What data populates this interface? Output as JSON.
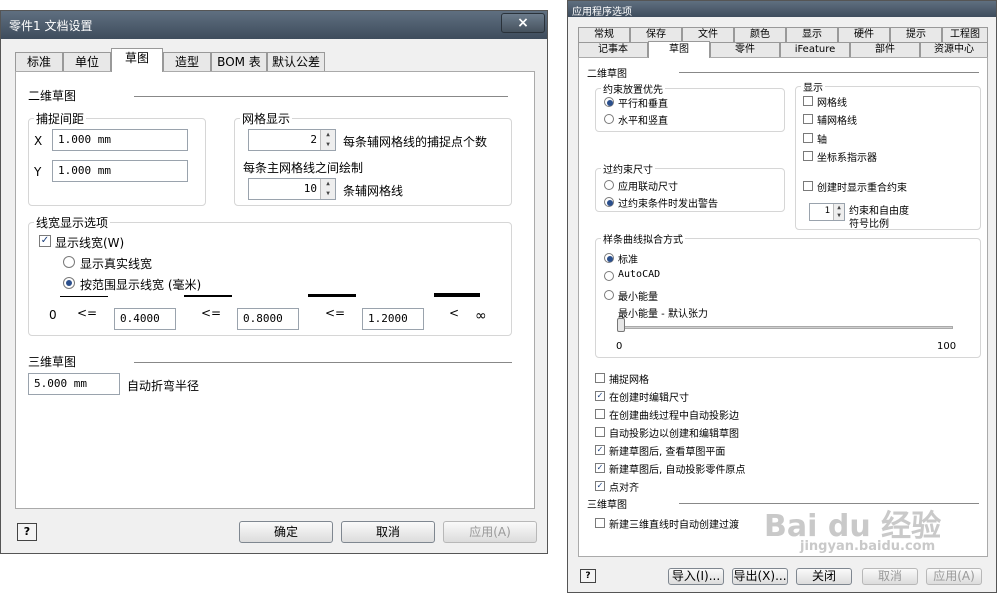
{
  "left": {
    "title": "零件1 文档设置",
    "close": "×",
    "tabs": [
      "标准",
      "单位",
      "草图",
      "造型",
      "BOM 表",
      "默认公差"
    ],
    "sketch2d_heading": "二维草图",
    "snap": {
      "label": "捕捉间距",
      "x_label": "X",
      "x_value": "1.000 mm",
      "y_label": "Y",
      "y_value": "1.000 mm"
    },
    "grid": {
      "label": "网格显示",
      "snap_per_minor": "2",
      "snap_per_minor_label": "每条辅网格线的捕捉点个数",
      "major_every_label": "每条主网格线之间绘制",
      "minor_per_major": "10",
      "minor_per_major_label": "条辅网格线"
    },
    "lineweight": {
      "label": "线宽显示选项",
      "display_label": "显示线宽(W)",
      "true_label": "显示真实线宽",
      "range_label": "按范围显示线宽 (毫米)",
      "zero": "0",
      "le": "<=",
      "lt": "<",
      "inf": "∞",
      "v1": "0.4000",
      "v2": "0.8000",
      "v3": "1.2000"
    },
    "sketch3d_heading": "三维草图",
    "bend_value": "5.000 mm",
    "bend_label": "自动折弯半径",
    "help": "?",
    "ok": "确定",
    "cancel": "取消",
    "apply": "应用(A)"
  },
  "right": {
    "title": "应用程序选项",
    "tabs_row1": [
      "常规",
      "保存",
      "文件",
      "颜色",
      "显示",
      "硬件",
      "提示",
      "工程图"
    ],
    "tabs_row2": [
      "记事本",
      "草图",
      "零件",
      "iFeature",
      "部件",
      "资源中心"
    ],
    "sketch2d_heading": "二维草图",
    "constraint": {
      "label": "约束放置优先",
      "opt1": "平行和垂直",
      "opt2": "水平和竖直"
    },
    "display": {
      "label": "显示",
      "grid_lines": "网格线",
      "minor_grid_lines": "辅网格线",
      "axes": "轴",
      "coord_indicator": "坐标系指示器",
      "show_coincident": "创建时显示重合约束",
      "dof_value": "1",
      "dof_label1": "约束和自由度",
      "dof_label2": "符号比例"
    },
    "overconstrained": {
      "label": "过约束尺寸",
      "opt1": "应用联动尺寸",
      "opt2": "过约束条件时发出警告"
    },
    "spline": {
      "label": "样条曲线拟合方式",
      "opt1": "标准",
      "opt2": "AutoCAD",
      "opt3": "最小能量",
      "tension_label": "最小能量 - 默认张力",
      "min": "0",
      "max": "100",
      "tension_value": 0
    },
    "checks": [
      {
        "label": "捕捉网格",
        "checked": false
      },
      {
        "label": "在创建时编辑尺寸",
        "checked": true
      },
      {
        "label": "在创建曲线过程中自动投影边",
        "checked": false
      },
      {
        "label": "自动投影边以创建和编辑草图",
        "checked": false
      },
      {
        "label": "新建草图后, 查看草图平面",
        "checked": true
      },
      {
        "label": "新建草图后, 自动投影零件原点",
        "checked": true
      },
      {
        "label": "点对齐",
        "checked": true
      }
    ],
    "sketch3d_heading": "三维草图",
    "auto_bend_label": "新建三维直线时自动创建过渡",
    "help": "?",
    "import": "导入(I)...",
    "export": "导出(X)...",
    "close": "关闭",
    "cancel": "取消",
    "apply": "应用(A)"
  },
  "watermark": {
    "brand": "Bai du 经验",
    "url": "jingyan.baidu.com"
  }
}
